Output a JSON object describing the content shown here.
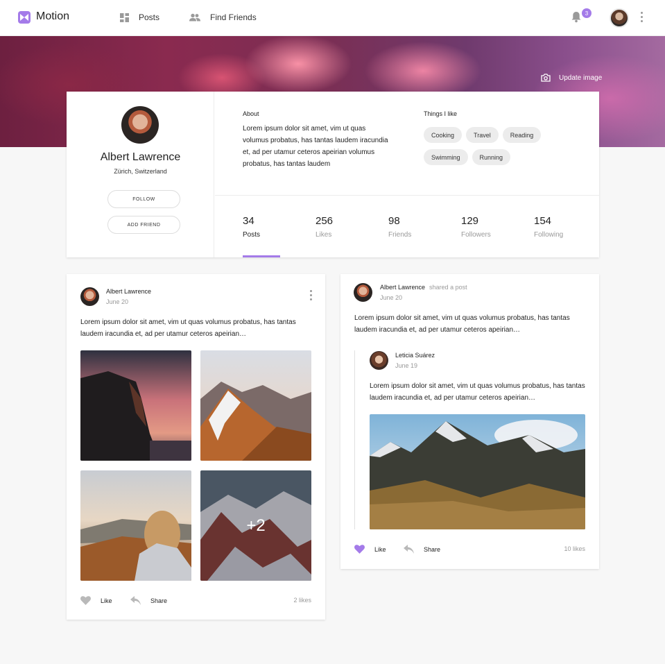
{
  "app": {
    "name": "Motion"
  },
  "nav": [
    {
      "label": "Posts",
      "icon": "dashboard-icon"
    },
    {
      "label": "Find Friends",
      "icon": "people-icon"
    }
  ],
  "notifications": {
    "count": "3"
  },
  "colors": {
    "accent": "#a47be9"
  },
  "cover": {
    "update_label": "Update image"
  },
  "profile": {
    "name": "Albert Lawrence",
    "location": "Zürich, Switzerland",
    "follow_label": "FOLLOW",
    "add_friend_label": "ADD FRIEND",
    "about_title": "About",
    "about_text": "Lorem ipsum dolor sit amet, vim ut quas volumus probatus, has tantas laudem iracundia et, ad per utamur ceteros apeirian volumus probatus, has tantas laudem",
    "things_title": "Things I like",
    "tags": [
      "Cooking",
      "Travel",
      "Reading",
      "Swimming",
      "Running"
    ],
    "stats": [
      {
        "value": "34",
        "label": "Posts"
      },
      {
        "value": "256",
        "label": "Likes"
      },
      {
        "value": "98",
        "label": "Friends"
      },
      {
        "value": "129",
        "label": "Followers"
      },
      {
        "value": "154",
        "label": "Following"
      }
    ]
  },
  "posts": [
    {
      "author": "Albert Lawrence",
      "date": "June 20",
      "text": "Lorem ipsum dolor sit amet, vim ut quas volumus probatus, has tantas laudem iracundia et, ad per utamur ceteros apeirian…",
      "more_photos": "+2",
      "like_label": "Like",
      "share_label": "Share",
      "likes": "2 likes"
    },
    {
      "author": "Albert Lawrence",
      "action_text": "shared a post",
      "date": "June 20",
      "text": "Lorem ipsum dolor sit amet, vim ut quas volumus probatus, has tantas laudem iracundia et, ad per utamur ceteros apeirian…",
      "shared_post": {
        "author": "Leticia Suárez",
        "date": "June 19",
        "text": "Lorem ipsum dolor sit amet, vim ut quas volumus probatus, has tantas laudem iracundia et, ad per utamur ceteros apeirian…"
      },
      "like_label": "Like",
      "share_label": "Share",
      "likes": "10 likes"
    }
  ]
}
